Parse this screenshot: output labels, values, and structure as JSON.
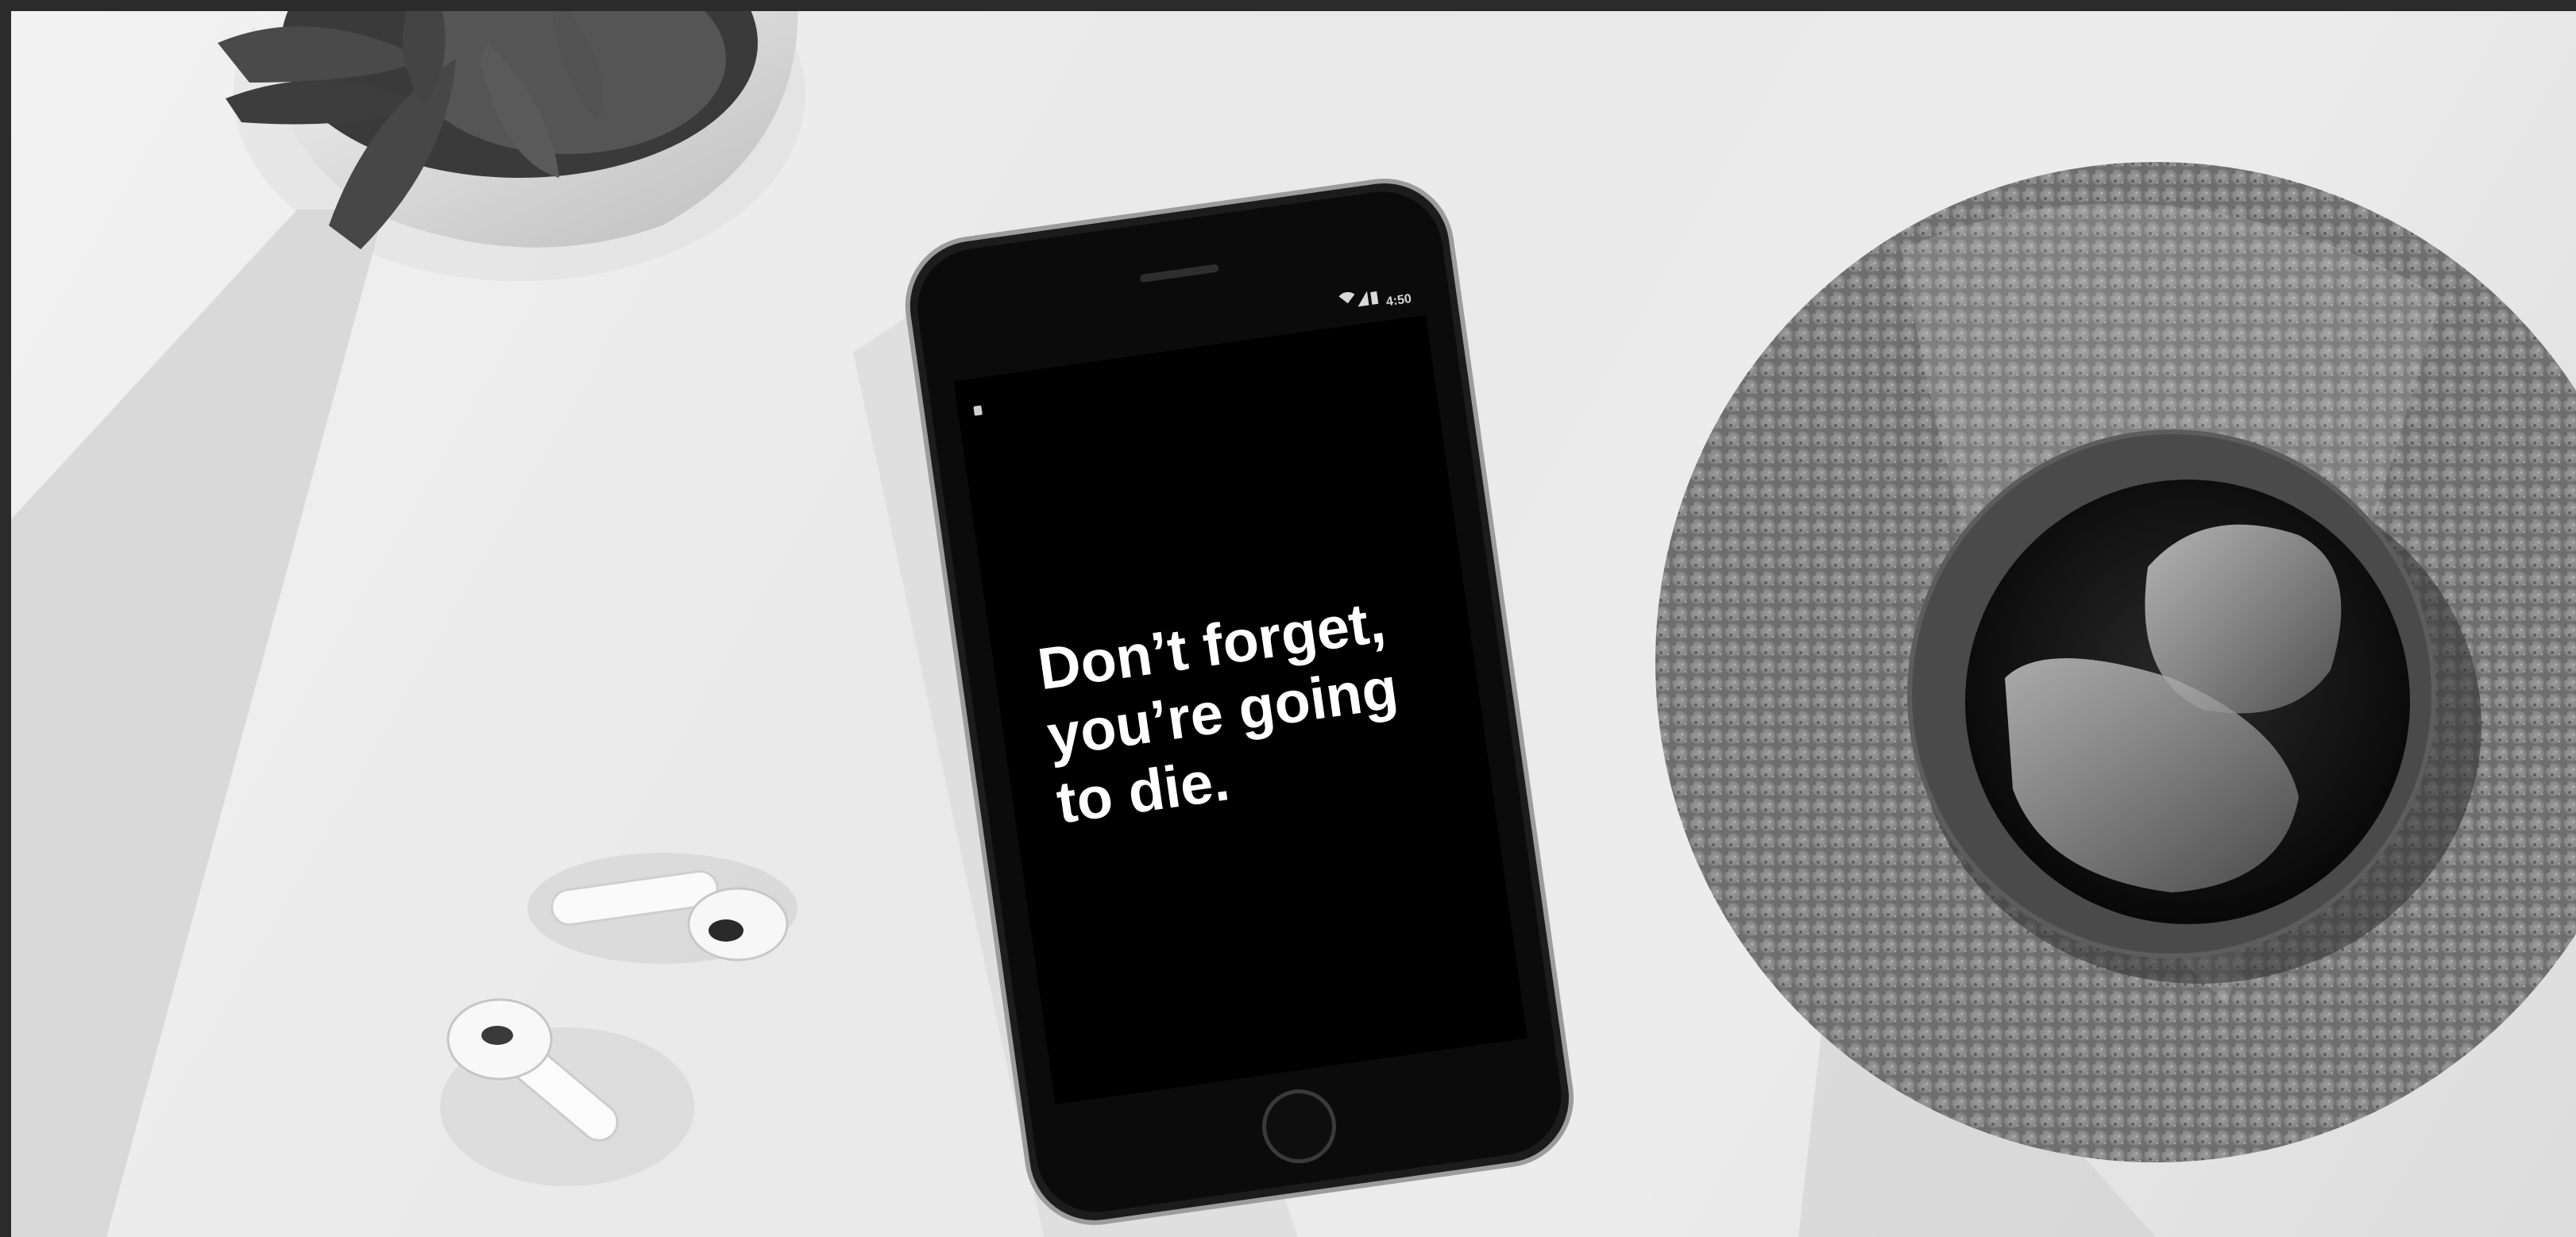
{
  "photo": {
    "style": "black-and-white",
    "phone": {
      "status_time": "4:50",
      "screen_lines": [
        "Don’t forget,",
        "you’re going",
        "to die."
      ]
    },
    "colors": {
      "frame_border": "#2b2b2b",
      "table": "#ececec",
      "screen": "#000000",
      "cork": "#8c8c8c"
    }
  }
}
